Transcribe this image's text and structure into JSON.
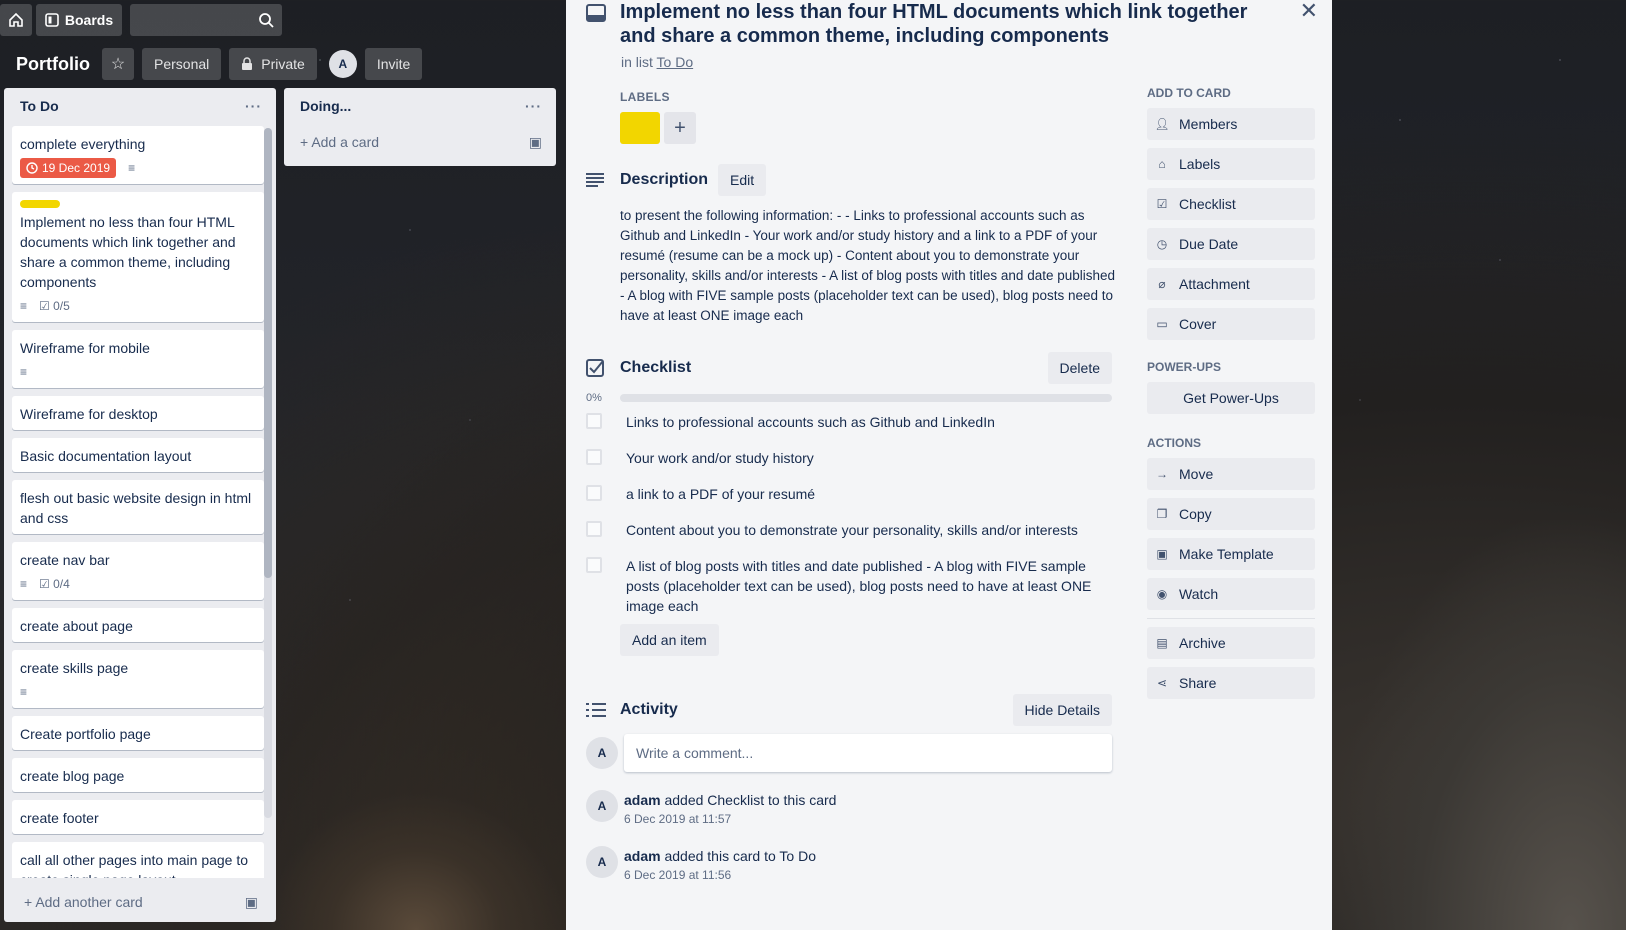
{
  "header": {
    "boards_label": "Boards",
    "board_title": "Portfolio",
    "personal_label": "Personal",
    "private_label": "Private",
    "member_initial": "A",
    "invite_label": "Invite"
  },
  "lists": {
    "todo": {
      "title": "To Do",
      "menu": "···",
      "add_label": "Add another card",
      "cards": [
        {
          "title": "complete everything",
          "due": "19 Dec 2019"
        },
        {
          "title": "Implement no less than four HTML documents which link together and share a common theme, including components",
          "checklist": "0/5"
        },
        {
          "title": "Wireframe for mobile"
        },
        {
          "title": "Wireframe for desktop"
        },
        {
          "title": "Basic documentation layout"
        },
        {
          "title": "flesh out basic website design in html and css"
        },
        {
          "title": "create nav bar",
          "checklist": "0/4"
        },
        {
          "title": "create about page"
        },
        {
          "title": "create skills page"
        },
        {
          "title": "Create portfolio page"
        },
        {
          "title": "create blog page"
        },
        {
          "title": "create footer"
        },
        {
          "title": "call all other pages into main page to create single page layout"
        }
      ]
    },
    "doing": {
      "title": "Doing...",
      "menu": "···",
      "add_label": "Add a card"
    }
  },
  "modal": {
    "title": "Implement no less than four HTML documents which link together and share a common theme, including components",
    "in_list_prefix": "in list",
    "in_list_name": "To Do",
    "labels_heading": "LABELS",
    "label_color": "#f2d600",
    "description": {
      "heading": "Description",
      "edit_label": "Edit",
      "text": "to present the following information: - - Links to professional accounts such as Github and LinkedIn - Your work and/or study history and a link to a PDF of your resumé (resume can be a mock up) - Content about you to demonstrate your personality, skills and/or interests - A list of blog posts with titles and date published - A blog with FIVE sample posts (placeholder text can be used), blog posts need to have at least ONE image each"
    },
    "checklist": {
      "heading": "Checklist",
      "delete_label": "Delete",
      "progress_label": "0%",
      "progress": 0,
      "items": [
        "Links to professional accounts such as Github and LinkedIn",
        "Your work and/or study history",
        "a link to a PDF of your resumé",
        "Content about you to demonstrate your personality, skills and/or interests",
        "A list of blog posts with titles and date published - A blog with FIVE sample posts (placeholder text can be used), blog posts need to have at least ONE image each"
      ],
      "add_item_label": "Add an item"
    },
    "activity": {
      "heading": "Activity",
      "hide_details_label": "Hide Details",
      "comment_placeholder": "Write a comment...",
      "avatar_initial": "A",
      "entries": [
        {
          "user": "adam",
          "action": "added Checklist to this card",
          "time": "6 Dec 2019 at 11:57"
        },
        {
          "user": "adam",
          "action": "added this card to To Do",
          "time": "6 Dec 2019 at 11:56"
        }
      ]
    },
    "sidebar": {
      "add_to_card_heading": "ADD TO CARD",
      "add_to_card": [
        {
          "label": "Members",
          "icon": "person-icon"
        },
        {
          "label": "Labels",
          "icon": "tag-icon"
        },
        {
          "label": "Checklist",
          "icon": "checkbox-icon"
        },
        {
          "label": "Due Date",
          "icon": "clock-icon"
        },
        {
          "label": "Attachment",
          "icon": "paperclip-icon"
        },
        {
          "label": "Cover",
          "icon": "cover-icon"
        }
      ],
      "powerups_heading": "POWER-UPS",
      "get_powerups_label": "Get Power-Ups",
      "actions_heading": "ACTIONS",
      "actions": [
        {
          "label": "Move",
          "icon": "arrow-right-icon"
        },
        {
          "label": "Copy",
          "icon": "copy-icon"
        },
        {
          "label": "Make Template",
          "icon": "template-icon"
        },
        {
          "label": "Watch",
          "icon": "eye-icon"
        },
        {
          "label": "Archive",
          "icon": "archive-icon"
        },
        {
          "label": "Share",
          "icon": "share-icon"
        }
      ]
    }
  }
}
